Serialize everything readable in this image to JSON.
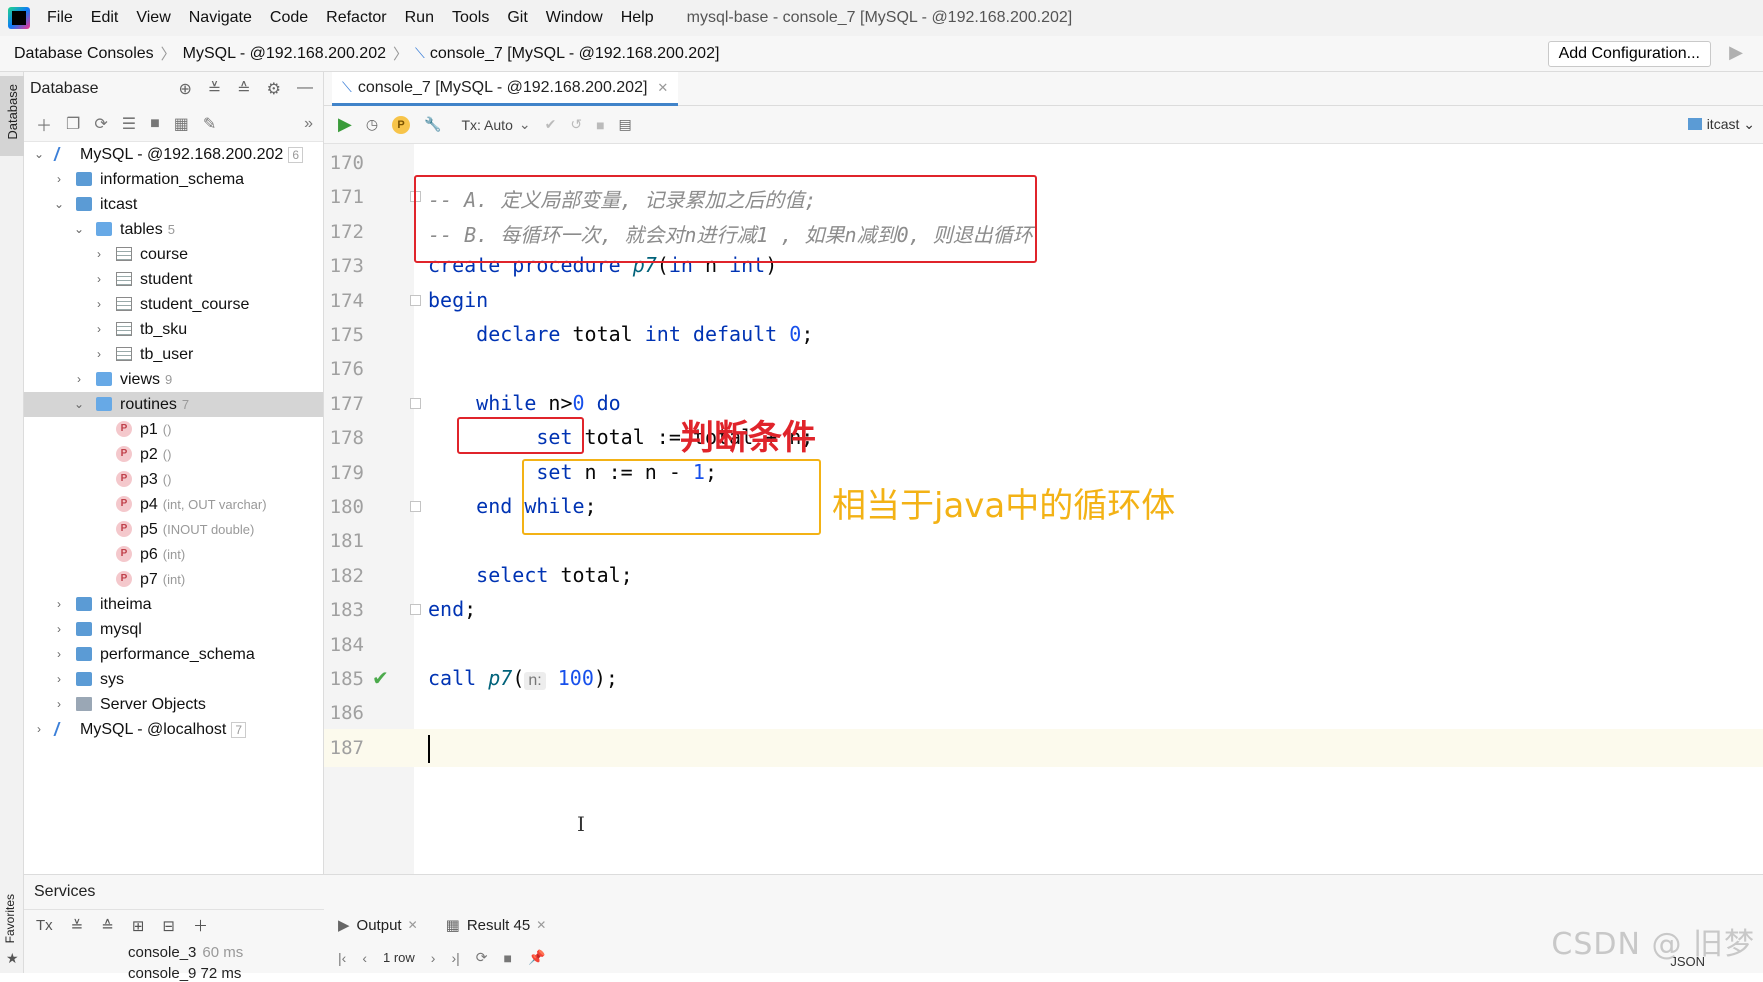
{
  "menu": {
    "items": [
      "File",
      "Edit",
      "View",
      "Navigate",
      "Code",
      "Refactor",
      "Run",
      "Tools",
      "Git",
      "Window",
      "Help"
    ],
    "window_title": "mysql-base - console_7 [MySQL - @192.168.200.202]"
  },
  "breadcrumb": {
    "items": [
      "Database Consoles",
      "MySQL - @192.168.200.202",
      "console_7 [MySQL - @192.168.200.202]"
    ],
    "add_configuration": "Add Configuration..."
  },
  "side_tabs": {
    "database": "Database",
    "favorites": "Favorites"
  },
  "db_panel": {
    "title": "Database",
    "tree": [
      {
        "label": "MySQL - @192.168.200.202",
        "count": "6",
        "icon": "server-icon",
        "depth": 0,
        "expanded": true
      },
      {
        "label": "information_schema",
        "count": "",
        "icon": "schema-icon",
        "depth": 1,
        "expanded": false
      },
      {
        "label": "itcast",
        "count": "",
        "icon": "schema-icon",
        "depth": 1,
        "expanded": true
      },
      {
        "label": "tables",
        "count": "5",
        "icon": "folder-icon",
        "depth": 2,
        "expanded": true
      },
      {
        "label": "course",
        "count": "",
        "icon": "table-icon",
        "depth": 3,
        "expanded": false
      },
      {
        "label": "student",
        "count": "",
        "icon": "table-icon",
        "depth": 3,
        "expanded": false
      },
      {
        "label": "student_course",
        "count": "",
        "icon": "table-icon",
        "depth": 3,
        "expanded": false
      },
      {
        "label": "tb_sku",
        "count": "",
        "icon": "table-icon",
        "depth": 3,
        "expanded": false
      },
      {
        "label": "tb_user",
        "count": "",
        "icon": "table-icon",
        "depth": 3,
        "expanded": false
      },
      {
        "label": "views",
        "count": "9",
        "icon": "folder-icon",
        "depth": 2,
        "expanded": false
      },
      {
        "label": "routines",
        "count": "7",
        "icon": "folder-icon",
        "depth": 2,
        "expanded": true,
        "selected": true
      },
      {
        "label": "p1",
        "count": "()",
        "icon": "procedure-icon",
        "depth": 3
      },
      {
        "label": "p2",
        "count": "()",
        "icon": "procedure-icon",
        "depth": 3
      },
      {
        "label": "p3",
        "count": "()",
        "icon": "procedure-icon",
        "depth": 3
      },
      {
        "label": "p4",
        "count": "(int, OUT varchar)",
        "icon": "procedure-icon",
        "depth": 3
      },
      {
        "label": "p5",
        "count": "(INOUT double)",
        "icon": "procedure-icon",
        "depth": 3
      },
      {
        "label": "p6",
        "count": "(int)",
        "icon": "procedure-icon",
        "depth": 3
      },
      {
        "label": "p7",
        "count": "(int)",
        "icon": "procedure-icon",
        "depth": 3
      },
      {
        "label": "itheima",
        "count": "",
        "icon": "schema-icon",
        "depth": 1,
        "expanded": false
      },
      {
        "label": "mysql",
        "count": "",
        "icon": "schema-icon",
        "depth": 1,
        "expanded": false
      },
      {
        "label": "performance_schema",
        "count": "",
        "icon": "schema-icon",
        "depth": 1,
        "expanded": false
      },
      {
        "label": "sys",
        "count": "",
        "icon": "schema-icon",
        "depth": 1,
        "expanded": false
      },
      {
        "label": "Server Objects",
        "count": "",
        "icon": "server-objects-icon",
        "depth": 1,
        "expanded": false
      },
      {
        "label": "MySQL - @localhost",
        "count": "7",
        "icon": "server-icon",
        "depth": 0,
        "expanded": false
      }
    ]
  },
  "editor": {
    "tab_label": "console_7 [MySQL - @192.168.200.202]",
    "tx_mode": "Tx: Auto",
    "schema": "itcast",
    "current_line": "187",
    "lines": [
      {
        "n": "170"
      },
      {
        "n": "171"
      },
      {
        "n": "172"
      },
      {
        "n": "173"
      },
      {
        "n": "174"
      },
      {
        "n": "175"
      },
      {
        "n": "176"
      },
      {
        "n": "177"
      },
      {
        "n": "178"
      },
      {
        "n": "179"
      },
      {
        "n": "180"
      },
      {
        "n": "181"
      },
      {
        "n": "182"
      },
      {
        "n": "183"
      },
      {
        "n": "184"
      },
      {
        "n": "185"
      },
      {
        "n": "186"
      },
      {
        "n": "187"
      }
    ],
    "code": {
      "comment_a": "-- A. 定义局部变量, 记录累加之后的值;",
      "comment_b": "-- B. 每循环一次, 就会对n进行减1 , 如果n减到0, 则退出循环",
      "l173_kw": "create procedure",
      "l173_fn": "p7",
      "l173_open": "(",
      "l173_in": "in",
      "l173_n": " n ",
      "l173_int": "int",
      "l173_close": ")",
      "l174": "begin",
      "l175_declare": "declare",
      "l175_total": " total ",
      "l175_int_default": "int default",
      "l175_zero": "0",
      "l175_semi": ";",
      "l177_while": "while",
      "l177_cond": " n>",
      "l177_zero": "0",
      "l177_do": "do",
      "l178_set": "set",
      "l178_rest": " total := total + n;",
      "l179_set": "set",
      "l179_rest": " n := n - ",
      "l179_one": "1",
      "l179_semi": ";",
      "l180": "end while",
      "l180_semi": ";",
      "l182_select": "select",
      "l182_rest": " total;",
      "l183": "end",
      "l183_semi": ";",
      "l185_call": "call",
      "l185_fn": "p7",
      "l185_open": "(",
      "l185_hint": "n:",
      "l185_arg": "100",
      "l185_close": ");"
    },
    "annotations": {
      "condition": "判断条件",
      "loop_body": "相当于java中的循环体"
    }
  },
  "services": {
    "title": "Services",
    "tx": "Tx",
    "tree_row1": "console_3",
    "tree_row1_time": "60 ms",
    "tree_row2": "console_9  72 ms",
    "output_tab": "Output",
    "result_tab": "Result 45",
    "rows": "1 row",
    "format": "JSON",
    "watermark": "CSDN @ 旧梦"
  },
  "colors": {
    "keyword": "#0033b3",
    "function": "#00627a",
    "number": "#1750eb",
    "comment": "#8c8c8c",
    "annotation_red": "#e0242b",
    "annotation_yellow": "#f3b215"
  }
}
